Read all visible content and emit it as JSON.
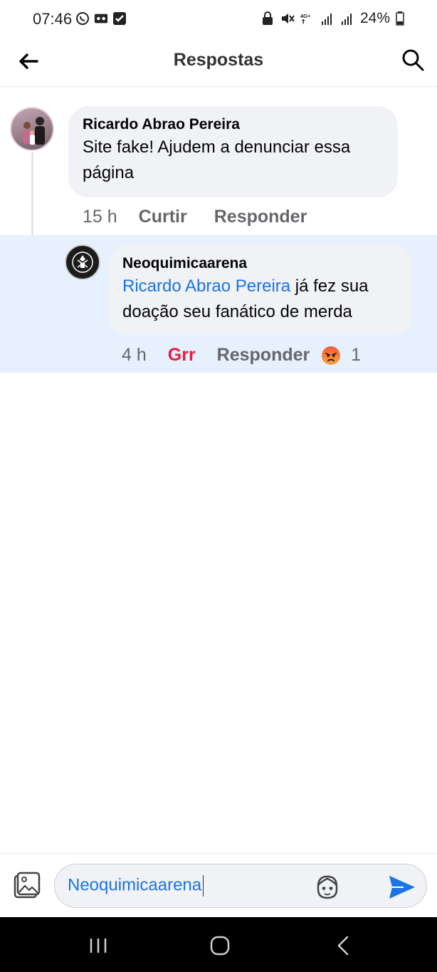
{
  "status_bar": {
    "time": "07:46",
    "battery": "24%",
    "network": "4G+"
  },
  "header": {
    "title": "Respostas"
  },
  "comments": [
    {
      "author": "Ricardo Abrao Pereira",
      "text": "Site fake! Ajudem a denunciar essa página",
      "time": "15 h",
      "like_label": "Curtir",
      "reply_label": "Responder"
    },
    {
      "author": "Neoquimicaarena",
      "mention": "Ricardo Abrao Pereira",
      "text": " já fez sua doação seu fanático de merda",
      "time": "4 h",
      "reaction_label": "Grr",
      "reply_label": "Responder",
      "reaction_count": "1"
    }
  ],
  "composer": {
    "value": "Neoquimicaarena"
  },
  "colors": {
    "accent": "#1b74e4",
    "angry": "#e41e3f",
    "highlight": "#e7f0fd"
  }
}
